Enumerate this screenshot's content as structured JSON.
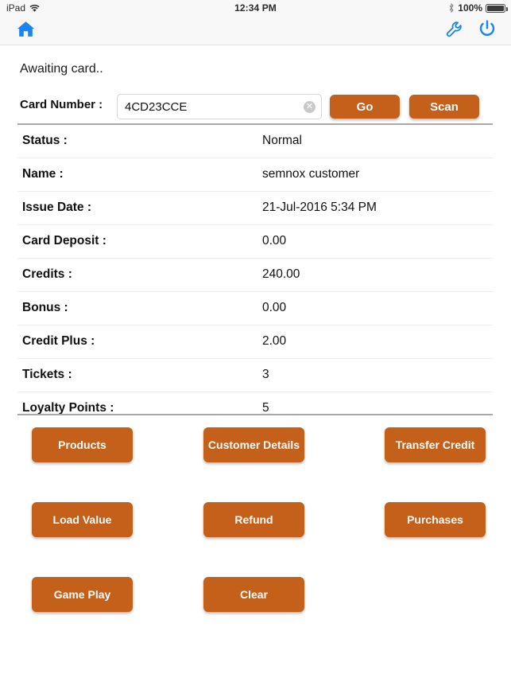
{
  "status_bar": {
    "device": "iPad",
    "wifi_icon": "wifi-icon",
    "time": "12:34 PM",
    "bluetooth_icon": "bluetooth-icon",
    "battery_percent": "100%",
    "battery_icon": "battery-full-icon"
  },
  "navbar": {
    "home_icon": "home-icon",
    "settings_icon": "wrench-icon",
    "power_icon": "power-icon",
    "icon_color": "#1b84f2",
    "background": "#f8f8f8"
  },
  "status_message": "Awaiting card..",
  "card_entry": {
    "label": "Card Number :",
    "value": "4CD23CCE",
    "placeholder": "",
    "clear_icon": "clear-circle-icon",
    "go_label": "Go",
    "scan_label": "Scan"
  },
  "theme": {
    "accent": "#c5601b",
    "accent_text": "#ffffff",
    "page_background": "#ffffff"
  },
  "details": {
    "rows": [
      {
        "label": "Status :",
        "value": "Normal"
      },
      {
        "label": "Name :",
        "value": "semnox  customer"
      },
      {
        "label": "Issue Date :",
        "value": "21-Jul-2016 5:34 PM"
      },
      {
        "label": "Card Deposit :",
        "value": "0.00"
      },
      {
        "label": "Credits :",
        "value": "240.00"
      },
      {
        "label": "Bonus :",
        "value": "0.00"
      },
      {
        "label": "Credit Plus :",
        "value": "2.00"
      },
      {
        "label": "Tickets :",
        "value": "3"
      },
      {
        "label": "Loyalty Points :",
        "value": "5"
      }
    ]
  },
  "actions": {
    "products": "Products",
    "customer_details": "Customer Details",
    "transfer_credit": "Transfer Credit",
    "load_value": "Load Value",
    "refund": "Refund",
    "purchases": "Purchases",
    "game_play": "Game Play",
    "clear": "Clear"
  }
}
